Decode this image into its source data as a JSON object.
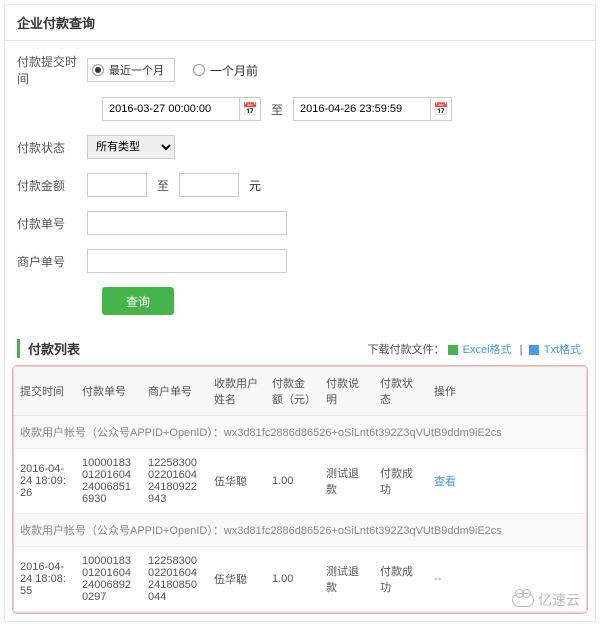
{
  "title": "企业付款查询",
  "form": {
    "time_label": "付款提交时间",
    "radio_recent": "最近一个月",
    "radio_before": "一个月前",
    "date_from": "2016-03-27 00:00:00",
    "date_to": "2016-04-26 23:59:59",
    "status_label": "付款状态",
    "status_value": "所有类型",
    "amount_label": "付款金额",
    "to_word": "至",
    "yuan": "元",
    "payno_label": "付款单号",
    "merno_label": "商户单号",
    "query_btn": "查询"
  },
  "list": {
    "header": "付款列表",
    "download_prefix": "下载付款文件：",
    "excel": "Excel格式",
    "txt": "Txt格式",
    "cols": {
      "c0": "提交时间",
      "c1": "付款单号",
      "c2": "商户单号",
      "c3": "收款用户姓名",
      "c4": "付款金额（元）",
      "c5": "付款说明",
      "c6": "付款状态",
      "c7": "操作"
    },
    "rows": [
      {
        "acct": "收款用户帐号（公众号APPID+OpenID）：wx3d81fc2886d86526+oSiLnt6t392Z3qVUtB9ddm9iE2cs",
        "time": "2016-04-24 18:09:26",
        "payno": "1000018301201604240068516930",
        "merno": "1225830002201604241809229​43",
        "name": "伍华聪",
        "amt": "1.00",
        "desc": "测试退款",
        "status": "付款成功",
        "op": "查看"
      },
      {
        "acct": "收款用户帐号（公众号APPID+OpenID）：wx3d81fc2886d86526+oSiLnt6t392Z3qVUtB9ddm9iE2cs",
        "time": "2016-04-24 18:08:55",
        "payno": "1000018301201604240068920297",
        "merno": "1225830002201604241808500​44",
        "name": "伍华聪",
        "amt": "1.00",
        "desc": "测试退款",
        "status": "付款成功",
        "op": "--"
      }
    ]
  },
  "watermark": "亿速云"
}
